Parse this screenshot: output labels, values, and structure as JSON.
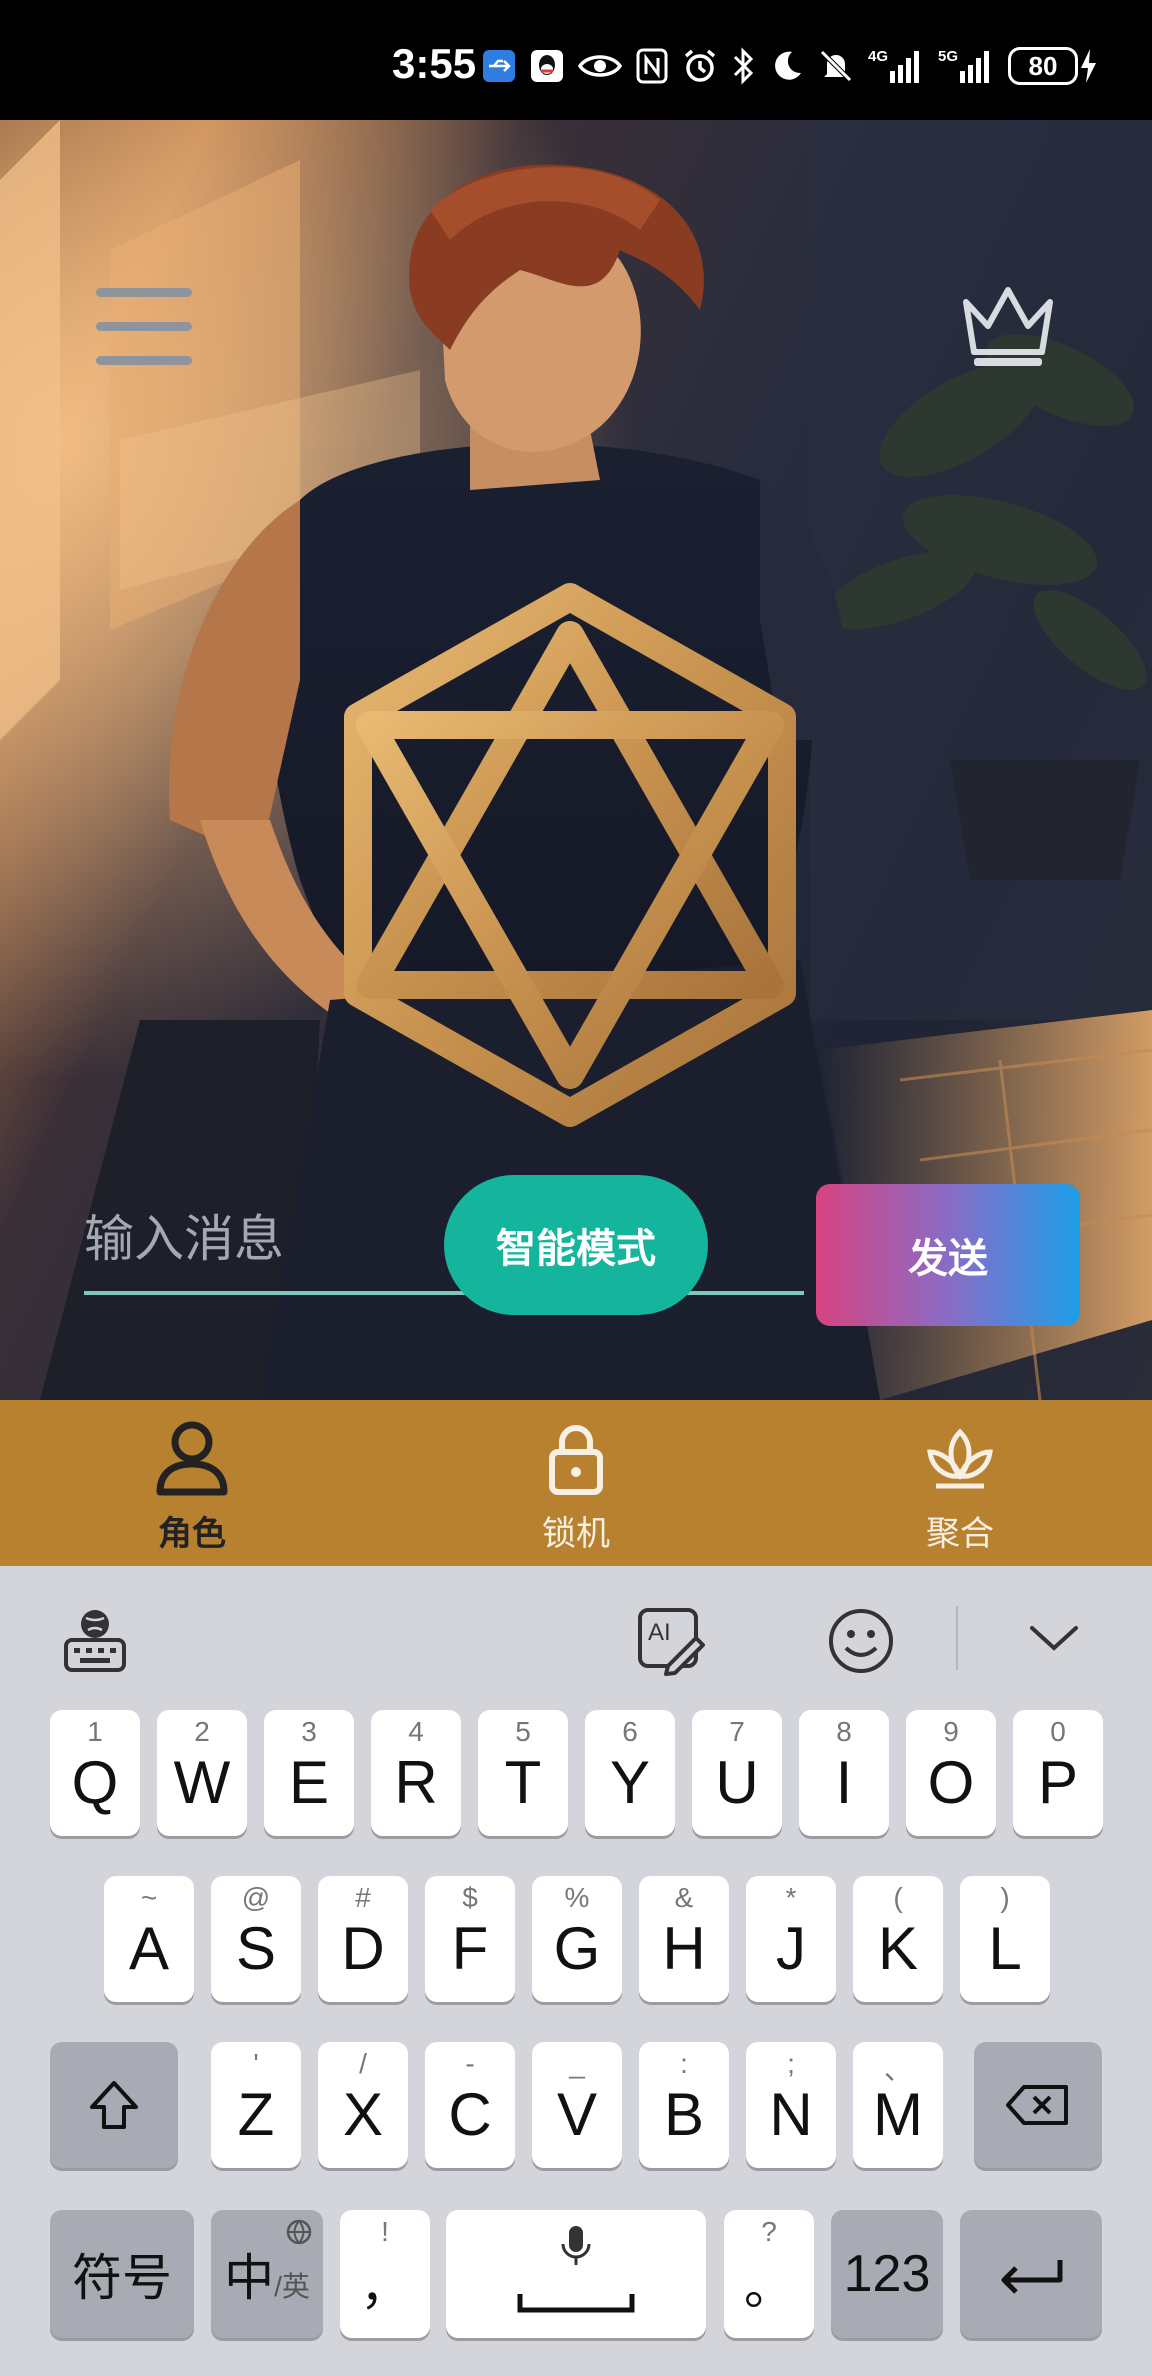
{
  "status_bar": {
    "time": "3:55",
    "battery": "80",
    "network_1": "4G",
    "network_2": "5G"
  },
  "hero": {
    "menu_icon": "hamburger-menu-icon",
    "vip_icon": "crown-icon",
    "emblem_icon": "hexagram-icon"
  },
  "composer": {
    "placeholder": "输入消息",
    "smart_mode_label": "智能模式",
    "send_label": "发送",
    "accent_color": "#15b49c"
  },
  "bottom_nav": {
    "background": "#b7812f",
    "items": [
      {
        "label": "角色",
        "icon": "person-icon",
        "active": true
      },
      {
        "label": "锁机",
        "icon": "lock-icon",
        "active": false
      },
      {
        "label": "聚合",
        "icon": "lotus-icon",
        "active": false
      }
    ]
  },
  "keyboard": {
    "toolbar": [
      "keyboard-settings-icon",
      "ai-write-icon",
      "emoji-icon",
      "collapse-keyboard-icon"
    ],
    "row1": [
      {
        "k": "Q",
        "s": "1"
      },
      {
        "k": "W",
        "s": "2"
      },
      {
        "k": "E",
        "s": "3"
      },
      {
        "k": "R",
        "s": "4"
      },
      {
        "k": "T",
        "s": "5"
      },
      {
        "k": "Y",
        "s": "6"
      },
      {
        "k": "U",
        "s": "7"
      },
      {
        "k": "I",
        "s": "8"
      },
      {
        "k": "O",
        "s": "9"
      },
      {
        "k": "P",
        "s": "0"
      }
    ],
    "row2": [
      {
        "k": "A",
        "s": "~"
      },
      {
        "k": "S",
        "s": "@"
      },
      {
        "k": "D",
        "s": "#"
      },
      {
        "k": "F",
        "s": "$"
      },
      {
        "k": "G",
        "s": "%"
      },
      {
        "k": "H",
        "s": "&"
      },
      {
        "k": "J",
        "s": "*"
      },
      {
        "k": "K",
        "s": "("
      },
      {
        "k": "L",
        "s": ")"
      }
    ],
    "row3": [
      {
        "k": "Z",
        "s": "'"
      },
      {
        "k": "X",
        "s": "/"
      },
      {
        "k": "C",
        "s": "-"
      },
      {
        "k": "V",
        "s": "_"
      },
      {
        "k": "B",
        "s": ":"
      },
      {
        "k": "N",
        "s": ";"
      },
      {
        "k": "M",
        "s": "、"
      }
    ],
    "symbols_label": "符号",
    "lang_main": "中",
    "lang_sub": "/英",
    "comma": "，",
    "comma_sub": "!",
    "period": "。",
    "period_sub": "?",
    "numbers_label": "123"
  }
}
